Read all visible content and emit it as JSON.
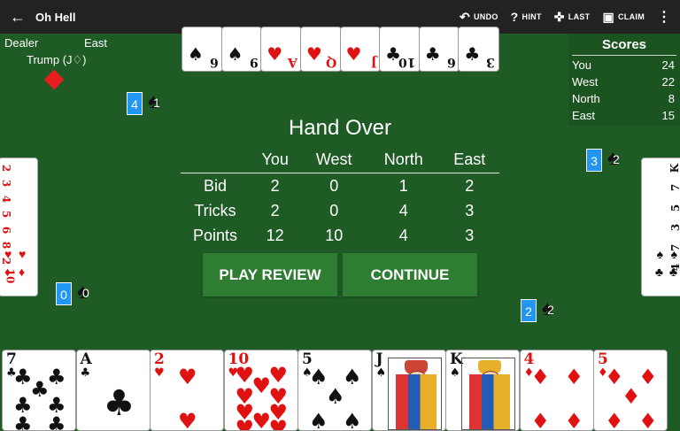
{
  "app": {
    "title": "Oh Hell",
    "back_icon": "←"
  },
  "toolbar": {
    "undo": {
      "icon": "↶",
      "label": "UNDO"
    },
    "hint": {
      "icon": "?",
      "label": "HINT"
    },
    "last": {
      "icon": "✜",
      "label": "LAST"
    },
    "claim": {
      "icon": "▣",
      "label": "CLAIM"
    },
    "more": "⋮"
  },
  "table_info": {
    "dealer": "Dealer",
    "dealer_name": "East",
    "trump_label": "Trump (J♢)",
    "trump_suit": "diamond"
  },
  "scores": {
    "title": "Scores",
    "rows": [
      {
        "name": "You",
        "score": "24"
      },
      {
        "name": "West",
        "score": "22"
      },
      {
        "name": "North",
        "score": "8"
      },
      {
        "name": "East",
        "score": "15"
      }
    ]
  },
  "bids": {
    "north": {
      "bid": "4",
      "tricks": "1"
    },
    "east": {
      "bid": "3",
      "tricks": "2"
    },
    "west": {
      "bid": "0",
      "tricks": "0"
    },
    "south": {
      "bid": "2",
      "tricks": "2"
    }
  },
  "hand_over": {
    "title": "Hand Over",
    "headers": [
      "",
      "You",
      "West",
      "North",
      "East"
    ],
    "rows": [
      [
        "Bid",
        "2",
        "0",
        "1",
        "2"
      ],
      [
        "Tricks",
        "2",
        "0",
        "4",
        "3"
      ],
      [
        "Points",
        "12",
        "10",
        "4",
        "3"
      ]
    ],
    "play_review": "PLAY REVIEW",
    "continue": "CONTINUE"
  },
  "hand": [
    {
      "rank": "7",
      "suit": "♣",
      "color": "#111111"
    },
    {
      "rank": "A",
      "suit": "♣",
      "color": "#111111"
    },
    {
      "rank": "2",
      "suit": "♥",
      "color": "#e01111"
    },
    {
      "rank": "10",
      "suit": "♥",
      "color": "#e01111"
    },
    {
      "rank": "5",
      "suit": "♠",
      "color": "#111111"
    },
    {
      "rank": "J",
      "suit": "♠",
      "color": "#111111"
    },
    {
      "rank": "K",
      "suit": "♠",
      "color": "#111111"
    },
    {
      "rank": "4",
      "suit": "♦",
      "color": "#e01111"
    },
    {
      "rank": "5",
      "suit": "♦",
      "color": "#e01111"
    }
  ],
  "north_cards": {
    "ranks": [
      "6",
      "9",
      "A",
      "Q",
      "J",
      "10",
      "6",
      "3"
    ],
    "suits": [
      "♠",
      "♠",
      "♥",
      "♥",
      "♥",
      "♣",
      "♣",
      "♣"
    ]
  },
  "west_cards": {
    "ranks": [
      "2",
      "3",
      "4",
      "5",
      "6",
      "8",
      "2",
      "10"
    ],
    "suits": [
      "♥",
      "♦"
    ]
  },
  "east_cards": {
    "ranks": [
      "K",
      "7",
      "5",
      "3",
      "7",
      "4"
    ],
    "suits": [
      "♠",
      "♣"
    ]
  },
  "colors": {
    "felt": "#1e5b25",
    "bar": "#222222",
    "bid_box": "#2196f3",
    "button": "#2e7d32"
  }
}
